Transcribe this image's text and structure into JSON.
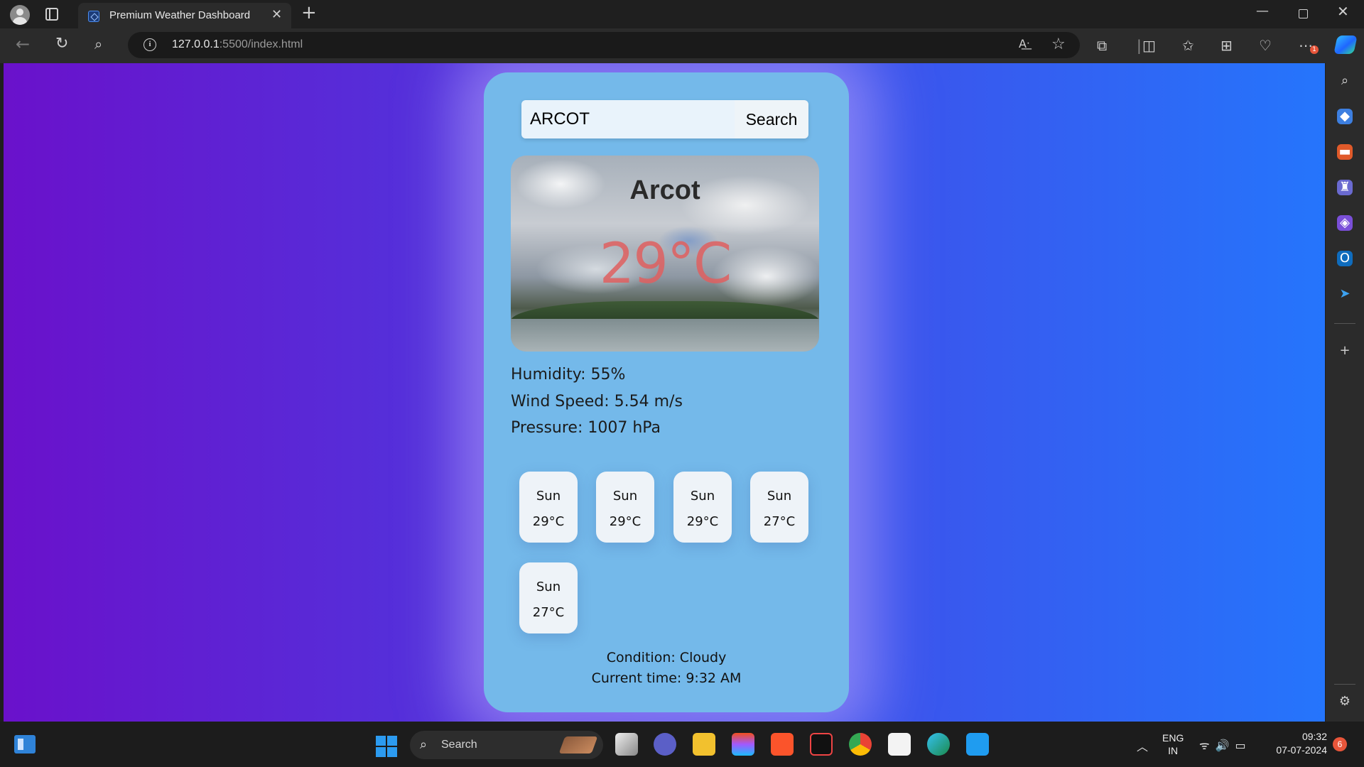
{
  "browser": {
    "tab_title": "Premium Weather Dashboard",
    "url_host": "127.0.0.1",
    "url_path": ":5500/index.html",
    "toolbar_badge": "1"
  },
  "search": {
    "value": "ARCOT",
    "button_label": "Search"
  },
  "weather": {
    "city": "Arcot",
    "temperature": "29°C",
    "humidity": "Humidity: 55%",
    "wind_speed": "Wind Speed: 5.54 m/s",
    "pressure": "Pressure: 1007 hPa",
    "condition": "Condition: Cloudy",
    "current_time": "Current time: 9:32 AM"
  },
  "forecast": [
    {
      "day": "Sun",
      "temp": "29°C"
    },
    {
      "day": "Sun",
      "temp": "29°C"
    },
    {
      "day": "Sun",
      "temp": "29°C"
    },
    {
      "day": "Sun",
      "temp": "27°C"
    },
    {
      "day": "Sun",
      "temp": "27°C"
    }
  ],
  "taskbar": {
    "search_label": "Search",
    "lang_top": "ENG",
    "lang_bottom": "IN",
    "time": "09:32",
    "date": "07-07-2024",
    "notifications": "6"
  },
  "colors": {
    "gradient_start": "#6a11cb",
    "gradient_end": "#2575fc",
    "card_bg": "#74b9ea",
    "temp_text": "#e06060"
  }
}
